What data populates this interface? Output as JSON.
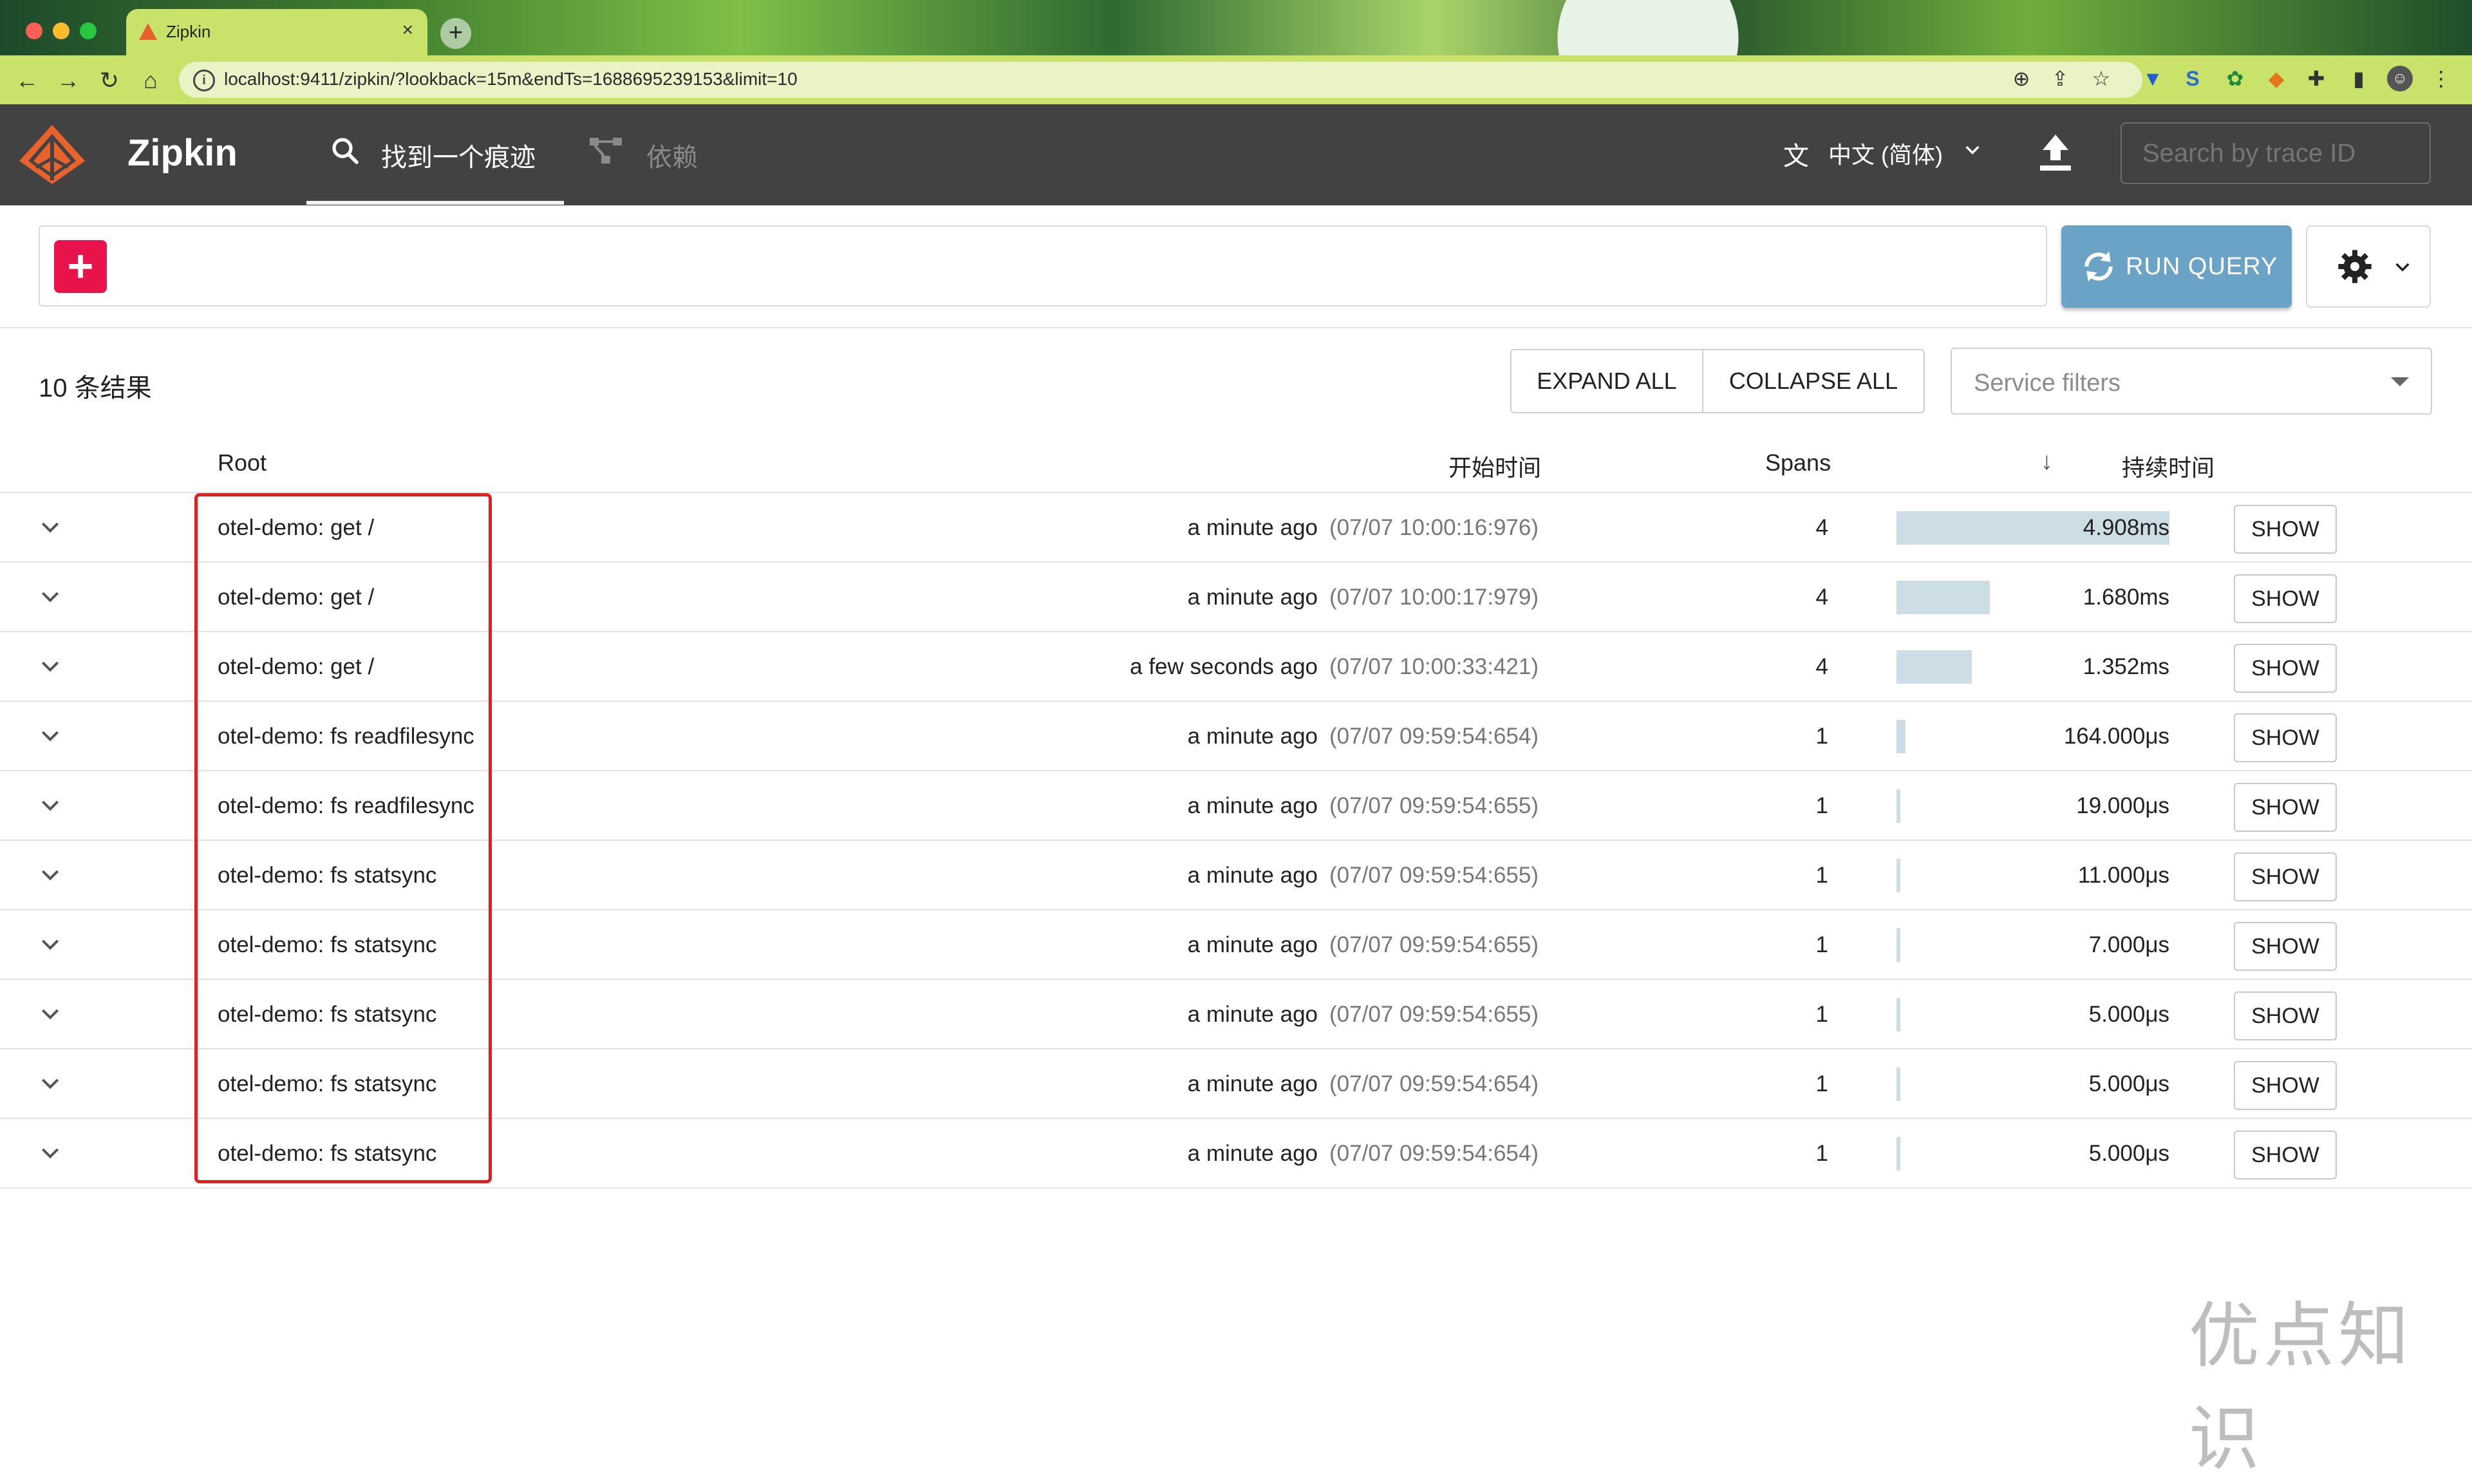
{
  "browser": {
    "tab_title": "Zipkin",
    "tab_close": "×",
    "new_tab": "+",
    "url": "localhost:9411/zipkin/?lookback=15m&endTs=1688695239153&limit=10"
  },
  "app": {
    "brand": "Zipkin",
    "nav": [
      {
        "label": "找到一个痕迹",
        "active": true
      },
      {
        "label": "依赖",
        "active": false
      }
    ],
    "language": "中文 (简体)",
    "search_placeholder": "Search by trace ID"
  },
  "query": {
    "add_label": "+",
    "run_label": "RUN QUERY"
  },
  "results": {
    "count_label": "10 条结果",
    "expand_all": "EXPAND ALL",
    "collapse_all": "COLLAPSE ALL",
    "service_filter_placeholder": "Service filters"
  },
  "table": {
    "headers": {
      "root": "Root",
      "start": "开始时间",
      "spans": "Spans",
      "duration": "持续时间"
    },
    "show_label": "SHOW",
    "rows": [
      {
        "root": "otel-demo: get /",
        "rel": "a minute ago",
        "abs": "(07/07 10:00:16:976)",
        "spans": "4",
        "duration": "4.908ms",
        "ratio": 1.0
      },
      {
        "root": "otel-demo: get /",
        "rel": "a minute ago",
        "abs": "(07/07 10:00:17:979)",
        "spans": "4",
        "duration": "1.680ms",
        "ratio": 0.342
      },
      {
        "root": "otel-demo: get /",
        "rel": "a few seconds ago",
        "abs": "(07/07 10:00:33:421)",
        "spans": "4",
        "duration": "1.352ms",
        "ratio": 0.275
      },
      {
        "root": "otel-demo: fs readfilesync",
        "rel": "a minute ago",
        "abs": "(07/07 09:59:54:654)",
        "spans": "1",
        "duration": "164.000μs",
        "ratio": 0.033
      },
      {
        "root": "otel-demo: fs readfilesync",
        "rel": "a minute ago",
        "abs": "(07/07 09:59:54:655)",
        "spans": "1",
        "duration": "19.000μs",
        "ratio": 0.0039
      },
      {
        "root": "otel-demo: fs statsync",
        "rel": "a minute ago",
        "abs": "(07/07 09:59:54:655)",
        "spans": "1",
        "duration": "11.000μs",
        "ratio": 0.0022
      },
      {
        "root": "otel-demo: fs statsync",
        "rel": "a minute ago",
        "abs": "(07/07 09:59:54:655)",
        "spans": "1",
        "duration": "7.000μs",
        "ratio": 0.0014
      },
      {
        "root": "otel-demo: fs statsync",
        "rel": "a minute ago",
        "abs": "(07/07 09:59:54:655)",
        "spans": "1",
        "duration": "5.000μs",
        "ratio": 0.001
      },
      {
        "root": "otel-demo: fs statsync",
        "rel": "a minute ago",
        "abs": "(07/07 09:59:54:654)",
        "spans": "1",
        "duration": "5.000μs",
        "ratio": 0.001
      },
      {
        "root": "otel-demo: fs statsync",
        "rel": "a minute ago",
        "abs": "(07/07 09:59:54:654)",
        "spans": "1",
        "duration": "5.000μs",
        "ratio": 0.001
      }
    ]
  },
  "watermark": "优点知识",
  "colors": {
    "appbar": "#424242",
    "accent_add": "#e8134b",
    "run_query": "#6ba3c7",
    "duration_bar": "#ccdde6",
    "highlight": "#e02020"
  }
}
